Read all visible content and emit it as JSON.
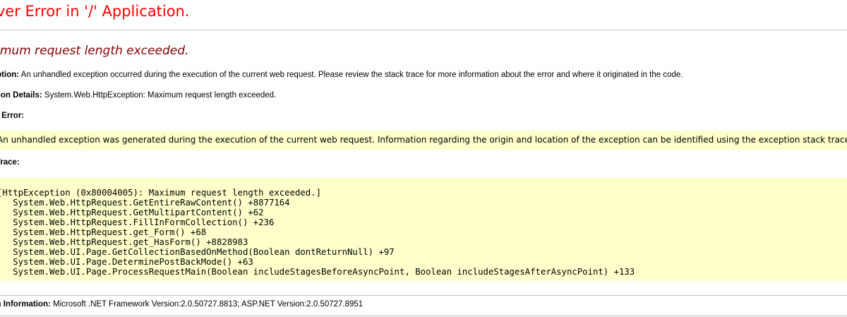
{
  "header": {
    "title": "Server Error in '/' Application.",
    "subtitle": "Maximum request length exceeded."
  },
  "description": {
    "label": "Description:",
    "text": "An unhandled exception occurred during the execution of the current web request. Please review the stack trace for more information about the error and where it originated in the code."
  },
  "exception_details": {
    "label": "Exception Details:",
    "text": "System.Web.HttpException: Maximum request length exceeded."
  },
  "source_error": {
    "label": "Source Error:",
    "text": "An unhandled exception was generated during the execution of the current web request. Information regarding the origin and location of the exception can be identified using the exception stack trace below."
  },
  "stack_trace": {
    "label": "Stack Trace:",
    "lines": [
      "[HttpException (0x80004005): Maximum request length exceeded.]",
      "   System.Web.HttpRequest.GetEntireRawContent() +8877164",
      "   System.Web.HttpRequest.GetMultipartContent() +62",
      "   System.Web.HttpRequest.FillInFormCollection() +236",
      "   System.Web.HttpRequest.get_Form() +68",
      "   System.Web.HttpRequest.get_HasForm() +8828983",
      "   System.Web.UI.Page.GetCollectionBasedOnMethod(Boolean dontReturnNull) +97",
      "   System.Web.UI.Page.DeterminePostBackMode() +63",
      "   System.Web.UI.Page.ProcessRequestMain(Boolean includeStagesBeforeAsyncPoint, Boolean includeStagesAfterAsyncPoint) +133"
    ]
  },
  "version_information": {
    "label": "Version Information:",
    "text": "Microsoft .NET Framework Version:2.0.50727.8813; ASP.NET Version:2.0.50727.8951"
  },
  "colors": {
    "title": "#ff0000",
    "subtitle": "#800000",
    "highlight_background": "#ffffcc",
    "rule": "#c0c0c0"
  }
}
